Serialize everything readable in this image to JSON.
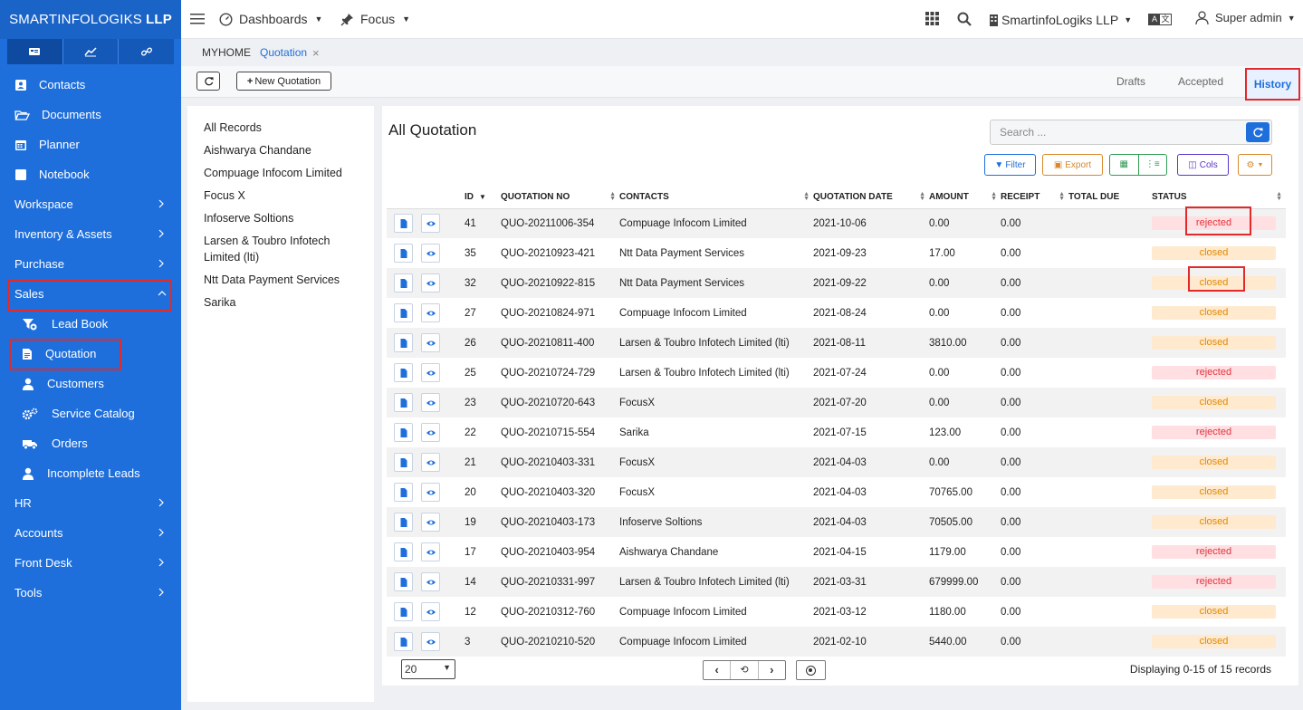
{
  "brand": {
    "name": "SMARTINFOLOGIKS",
    "suffix": "LLP"
  },
  "sidebar": {
    "items": [
      {
        "label": "Contacts",
        "icon": "contact-card-icon"
      },
      {
        "label": "Documents",
        "icon": "folder-open-icon"
      },
      {
        "label": "Planner",
        "icon": "calendar-icon"
      },
      {
        "label": "Notebook",
        "icon": "notebook-icon"
      },
      {
        "label": "Workspace"
      },
      {
        "label": "Inventory & Assets"
      },
      {
        "label": "Purchase"
      },
      {
        "label": "Sales"
      },
      {
        "label": "HR"
      },
      {
        "label": "Accounts"
      },
      {
        "label": "Front Desk"
      },
      {
        "label": "Tools"
      }
    ],
    "sales_sub": [
      {
        "label": "Lead Book"
      },
      {
        "label": "Quotation"
      },
      {
        "label": "Customers"
      },
      {
        "label": "Service Catalog"
      },
      {
        "label": "Orders"
      },
      {
        "label": "Incomplete Leads"
      }
    ]
  },
  "topbar": {
    "dashboards": "Dashboards",
    "focus": "Focus",
    "company": "SmartinfoLogiks LLP",
    "user": "Super admin"
  },
  "breadcrumb": {
    "home": "MYHOME",
    "current": "Quotation",
    "close": "×"
  },
  "toolbar": {
    "new_quotation": "New Quotation",
    "tabs": [
      "Drafts",
      "Accepted",
      "History"
    ],
    "active_tab": "History"
  },
  "records": {
    "items": [
      "All Records",
      "Aishwarya Chandane",
      "Compuage Infocom Limited",
      "Focus X",
      "Infoserve Soltions",
      "Larsen & Toubro Infotech Limited (lti)",
      "Ntt Data Payment Services",
      "Sarika"
    ]
  },
  "main": {
    "title": "All Quotation",
    "search_placeholder": "Search ...",
    "filter": "Filter",
    "export": "Export",
    "cols": "Cols"
  },
  "table": {
    "headers": [
      "ID",
      "QUOTATION NO",
      "CONTACTS",
      "QUOTATION DATE",
      "AMOUNT",
      "RECEIPT",
      "TOTAL DUE",
      "STATUS"
    ],
    "rows": [
      {
        "id": "41",
        "no": "QUO-20211006-354",
        "contact": "Compuage Infocom Limited",
        "date": "2021-10-06",
        "amount": "0.00",
        "receipt": "0.00",
        "status": "rejected"
      },
      {
        "id": "35",
        "no": "QUO-20210923-421",
        "contact": "Ntt Data Payment Services",
        "date": "2021-09-23",
        "amount": "17.00",
        "receipt": "0.00",
        "status": "closed"
      },
      {
        "id": "32",
        "no": "QUO-20210922-815",
        "contact": "Ntt Data Payment Services",
        "date": "2021-09-22",
        "amount": "0.00",
        "receipt": "0.00",
        "status": "closed"
      },
      {
        "id": "27",
        "no": "QUO-20210824-971",
        "contact": "Compuage Infocom Limited",
        "date": "2021-08-24",
        "amount": "0.00",
        "receipt": "0.00",
        "status": "closed"
      },
      {
        "id": "26",
        "no": "QUO-20210811-400",
        "contact": "Larsen & Toubro Infotech Limited (lti)",
        "date": "2021-08-11",
        "amount": "3810.00",
        "receipt": "0.00",
        "status": "closed"
      },
      {
        "id": "25",
        "no": "QUO-20210724-729",
        "contact": "Larsen & Toubro Infotech Limited (lti)",
        "date": "2021-07-24",
        "amount": "0.00",
        "receipt": "0.00",
        "status": "rejected"
      },
      {
        "id": "23",
        "no": "QUO-20210720-643",
        "contact": "FocusX",
        "date": "2021-07-20",
        "amount": "0.00",
        "receipt": "0.00",
        "status": "closed"
      },
      {
        "id": "22",
        "no": "QUO-20210715-554",
        "contact": "Sarika",
        "date": "2021-07-15",
        "amount": "123.00",
        "receipt": "0.00",
        "status": "rejected"
      },
      {
        "id": "21",
        "no": "QUO-20210403-331",
        "contact": "FocusX",
        "date": "2021-04-03",
        "amount": "0.00",
        "receipt": "0.00",
        "status": "closed"
      },
      {
        "id": "20",
        "no": "QUO-20210403-320",
        "contact": "FocusX",
        "date": "2021-04-03",
        "amount": "70765.00",
        "receipt": "0.00",
        "status": "closed"
      },
      {
        "id": "19",
        "no": "QUO-20210403-173",
        "contact": "Infoserve Soltions",
        "date": "2021-04-03",
        "amount": "70505.00",
        "receipt": "0.00",
        "status": "closed"
      },
      {
        "id": "17",
        "no": "QUO-20210403-954",
        "contact": "Aishwarya Chandane",
        "date": "2021-04-15",
        "amount": "1179.00",
        "receipt": "0.00",
        "status": "rejected"
      },
      {
        "id": "14",
        "no": "QUO-20210331-997",
        "contact": "Larsen & Toubro Infotech Limited (lti)",
        "date": "2021-03-31",
        "amount": "679999.00",
        "receipt": "0.00",
        "status": "rejected"
      },
      {
        "id": "12",
        "no": "QUO-20210312-760",
        "contact": "Compuage Infocom Limited",
        "date": "2021-03-12",
        "amount": "1180.00",
        "receipt": "0.00",
        "status": "closed"
      },
      {
        "id": "3",
        "no": "QUO-20210210-520",
        "contact": "Compuage Infocom Limited",
        "date": "2021-02-10",
        "amount": "5440.00",
        "receipt": "0.00",
        "status": "closed"
      }
    ]
  },
  "pager": {
    "page_size": "20",
    "page_size_options": [
      "20"
    ],
    "summary": "Displaying 0-15 of 15 records"
  },
  "colors": {
    "sidebar": "#1e6fdc",
    "highlight": "#e32a2a",
    "accent": "#1e6fdc"
  }
}
